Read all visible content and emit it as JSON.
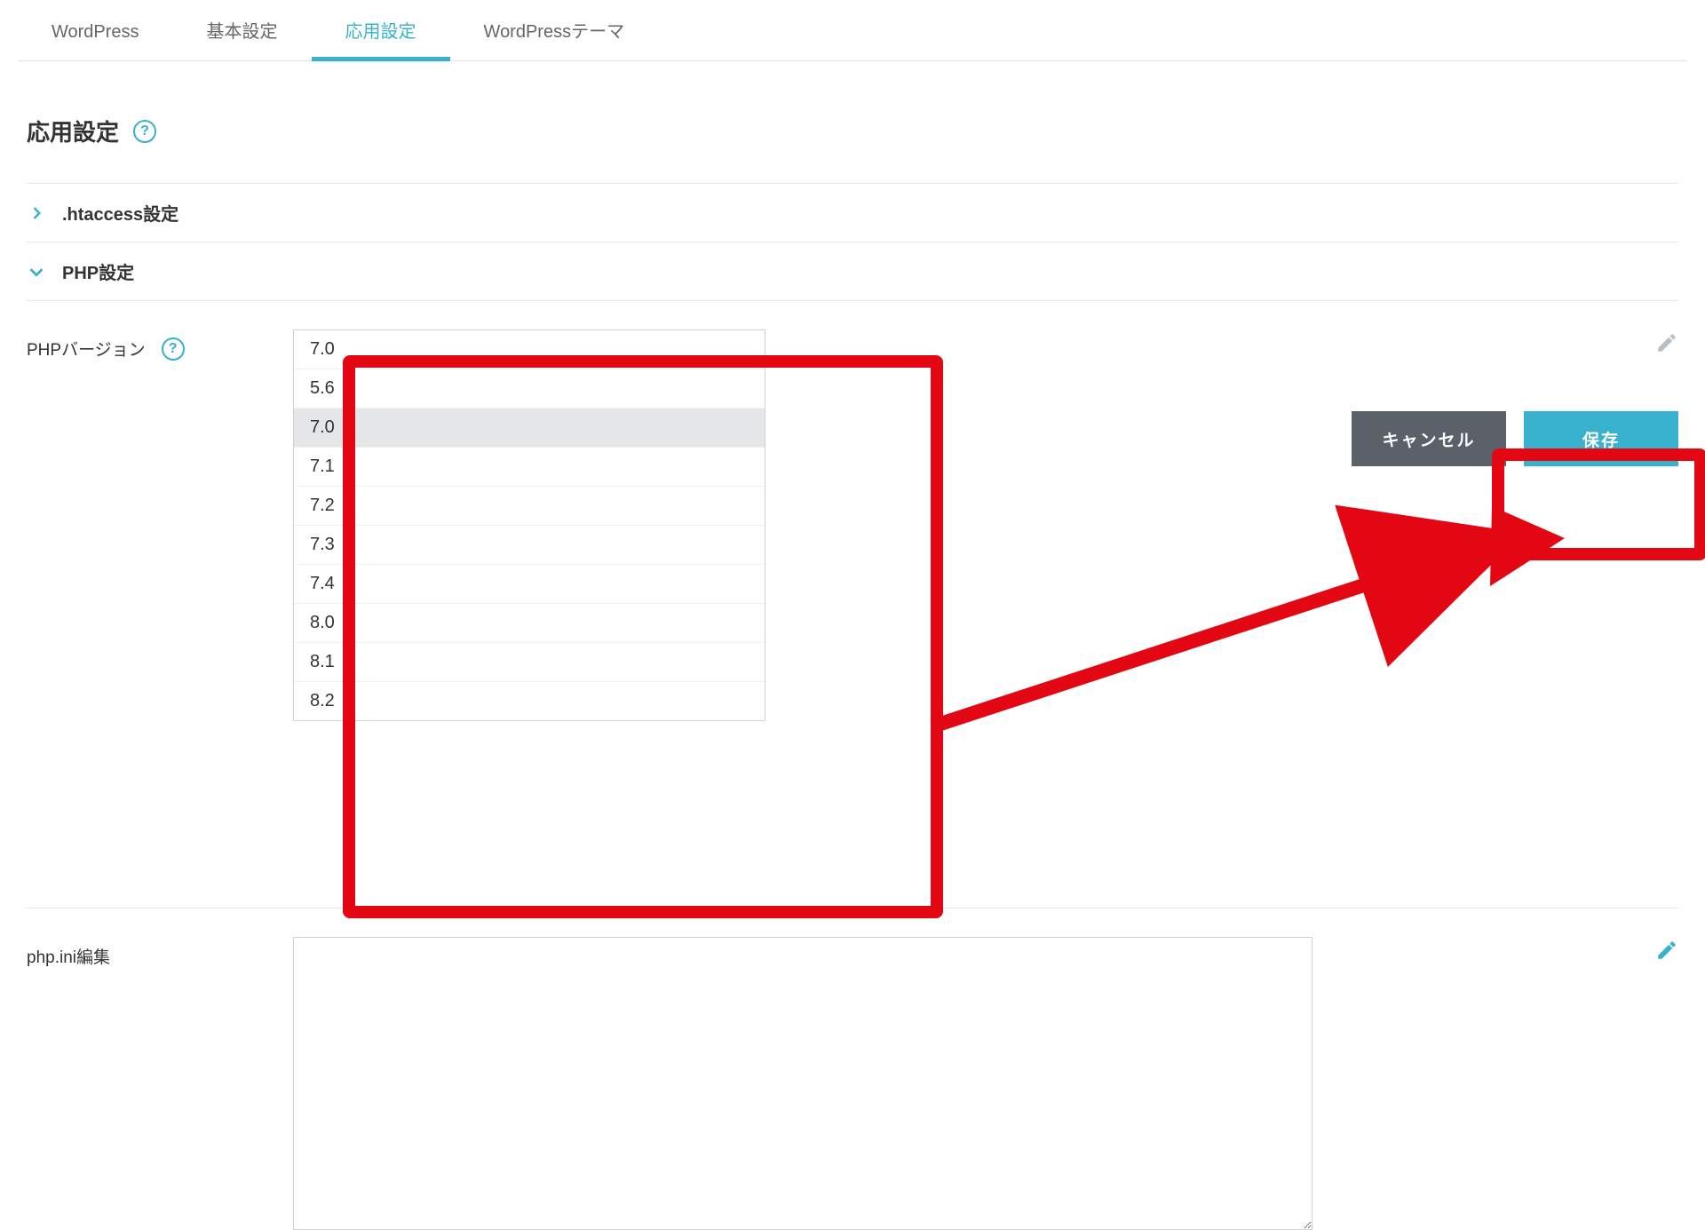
{
  "tabs": [
    {
      "label": "WordPress",
      "active": false
    },
    {
      "label": "基本設定",
      "active": false
    },
    {
      "label": "応用設定",
      "active": true
    },
    {
      "label": "WordPressテーマ",
      "active": false
    }
  ],
  "page_title": "応用設定",
  "sections": {
    "htaccess": {
      "label": ".htaccess設定",
      "expanded": false
    },
    "php": {
      "label": "PHP設定",
      "expanded": true
    }
  },
  "php_version": {
    "label": "PHPバージョン",
    "selected": "7.0",
    "options": [
      "7.0",
      "5.6",
      "7.0",
      "7.1",
      "7.2",
      "7.3",
      "7.4",
      "8.0",
      "8.1",
      "8.2"
    ]
  },
  "actions": {
    "cancel": "キャンセル",
    "save": "保存"
  },
  "php_ini": {
    "label": "php.ini編集",
    "value": ""
  },
  "colors": {
    "accent": "#38b1cc",
    "cancel": "#5a6168",
    "highlight": "#e30613"
  }
}
